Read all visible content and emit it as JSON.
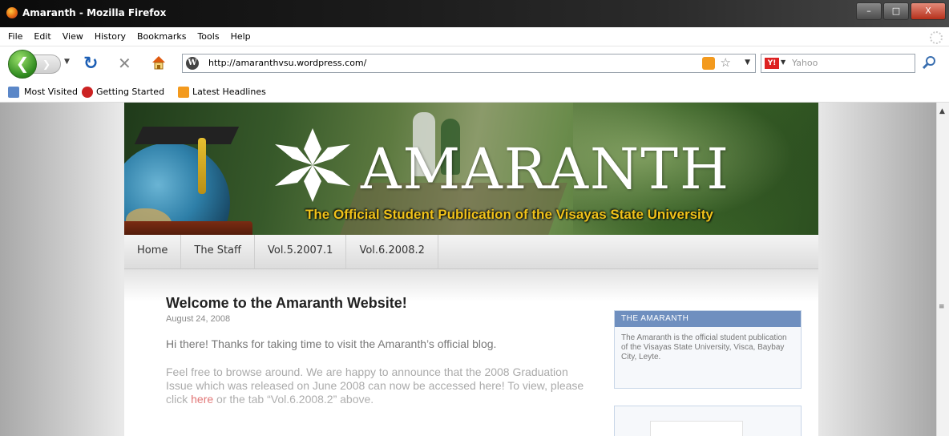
{
  "window": {
    "title": "Amaranth - Mozilla Firefox",
    "min": "–",
    "max": "□",
    "close": "X"
  },
  "menu": [
    "File",
    "Edit",
    "View",
    "History",
    "Bookmarks",
    "Tools",
    "Help"
  ],
  "nav": {
    "url": "http://amaranthvsu.wordpress.com/",
    "search_placeholder": "Yahoo",
    "yahoo_icon": "Y!"
  },
  "bookmarks": {
    "most_visited": "Most Visited",
    "getting_started": "Getting Started",
    "latest_headlines": "Latest Headlines"
  },
  "site": {
    "title": "AMARANTH",
    "tagline": "The Official Student Publication of the Visayas State University",
    "tabs": [
      "Home",
      "The Staff",
      "Vol.5.2007.1",
      "Vol.6.2008.2"
    ]
  },
  "post": {
    "title": "Welcome to the Amaranth Website!",
    "date": "August 24, 2008",
    "p1": "Hi there! Thanks for taking time to visit the Amaranth’s official blog.",
    "p2_start": "Feel free to browse around. We are happy to announce that the 2008 Graduation Issue which was released on June 2008 can now be accessed here! To view, please click ",
    "p2_link": "here",
    "p2_end": " or the tab “Vol.6.2008.2” above."
  },
  "sidebar": {
    "heading": "THE AMARANTH",
    "text": "The Amaranth is the official student publication of the Visayas State University, Visca, Baybay City, Leyte."
  },
  "colors": {
    "accent": "#6f8fbf",
    "tagline": "#f0c21a",
    "link": "#e07070"
  },
  "icons": {
    "back": "back-arrow-icon",
    "forward": "forward-arrow-icon",
    "reload": "reload-icon",
    "stop": "stop-icon",
    "home": "home-icon",
    "rss": "rss-icon",
    "star": "bookmark-star-icon",
    "search": "search-icon"
  }
}
